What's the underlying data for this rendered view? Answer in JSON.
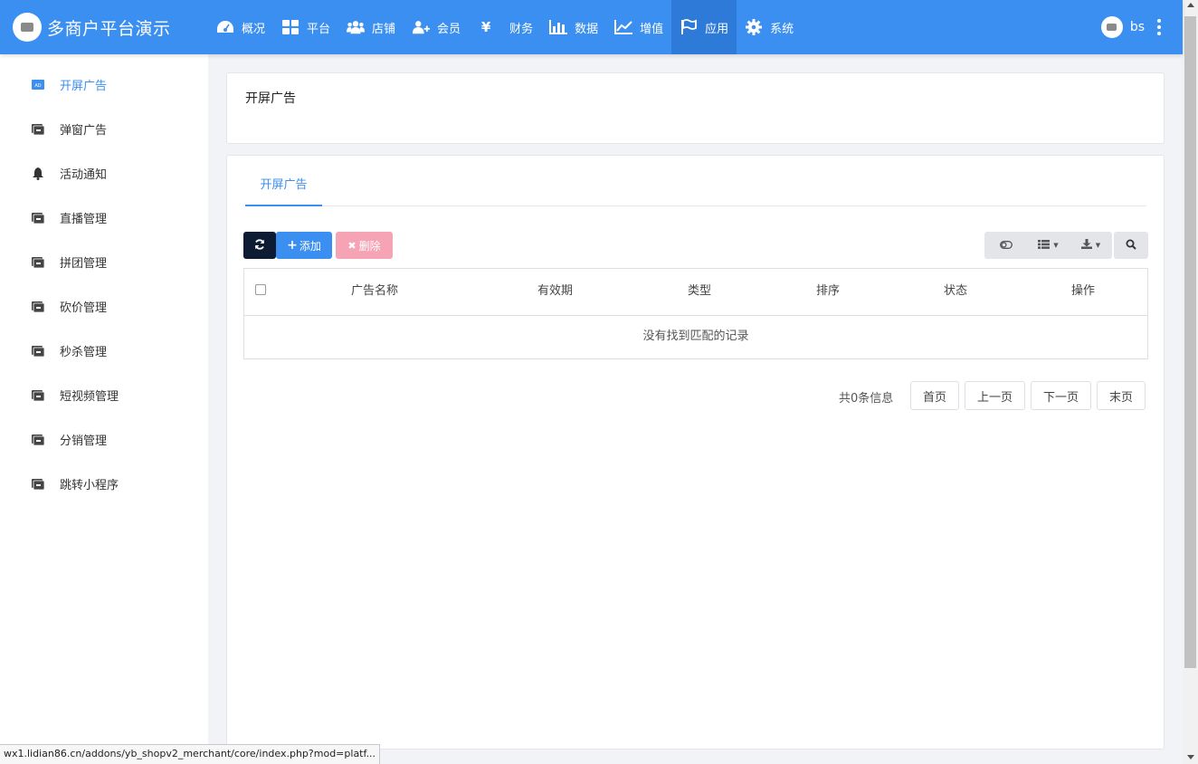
{
  "brand": {
    "title": "多商户平台演示"
  },
  "nav": {
    "items": [
      {
        "label": "概况",
        "icon": "dashboard-icon"
      },
      {
        "label": "平台",
        "icon": "grid-icon"
      },
      {
        "label": "店铺",
        "icon": "users-icon"
      },
      {
        "label": "会员",
        "icon": "user-plus-icon"
      },
      {
        "label": "财务",
        "icon": "yen-icon"
      },
      {
        "label": "数据",
        "icon": "bar-chart-icon"
      },
      {
        "label": "增值",
        "icon": "line-chart-icon"
      },
      {
        "label": "应用",
        "icon": "flag-icon",
        "active": true
      },
      {
        "label": "系统",
        "icon": "gear-icon"
      }
    ],
    "username": "bs"
  },
  "sidebar": {
    "items": [
      {
        "label": "开屏广告",
        "icon": "ad-icon",
        "active": true
      },
      {
        "label": "弹窗广告",
        "icon": "ad-icon"
      },
      {
        "label": "活动通知",
        "icon": "bell-icon"
      },
      {
        "label": "直播管理",
        "icon": "ad-icon"
      },
      {
        "label": "拼团管理",
        "icon": "ad-icon"
      },
      {
        "label": "砍价管理",
        "icon": "ad-icon"
      },
      {
        "label": "秒杀管理",
        "icon": "ad-icon"
      },
      {
        "label": "短视频管理",
        "icon": "ad-icon"
      },
      {
        "label": "分销管理",
        "icon": "ad-icon"
      },
      {
        "label": "跳转小程序",
        "icon": "ad-icon"
      }
    ]
  },
  "header_panel": {
    "title": "开屏广告"
  },
  "main": {
    "tab": "开屏广告",
    "toolbar": {
      "add_label": "添加",
      "delete_label": "删除"
    },
    "table": {
      "columns": [
        "广告名称",
        "有效期",
        "类型",
        "排序",
        "状态",
        "操作"
      ],
      "empty_text": "没有找到匹配的记录"
    },
    "pager": {
      "info": "共0条信息",
      "first": "首页",
      "prev": "上一页",
      "next": "下一页",
      "last": "末页"
    }
  },
  "statusbar": {
    "url": "wx1.lidian86.cn/addons/yb_shopv2_merchant/core/index.php?mod=platf..."
  },
  "colors": {
    "primary": "#3b8ff0",
    "navbar": "#3b8ff0",
    "nav_active": "#2d7ad9",
    "refresh_btn": "#0d1b33",
    "delete_btn": "#f5a3b5"
  }
}
